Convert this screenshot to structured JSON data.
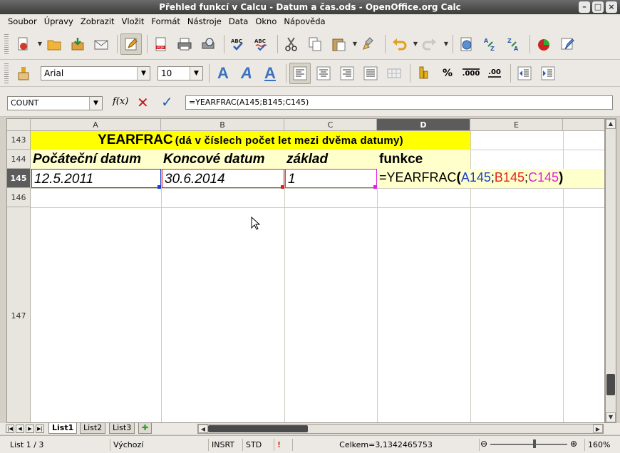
{
  "window": {
    "title": "Přehled funkcí v Calcu - Datum a čas.ods - OpenOffice.org Calc"
  },
  "menu": [
    "Soubor",
    "Úpravy",
    "Zobrazit",
    "Vložit",
    "Formát",
    "Nástroje",
    "Data",
    "Okno",
    "Nápověda"
  ],
  "format_toolbar": {
    "font_name": "Arial",
    "font_size": "10",
    "bold_a": "A",
    "italic_a": "A",
    "under_a": "A",
    "percent": "%",
    "decimal": ".000",
    "decimal2": ".00"
  },
  "formula_bar": {
    "name_box": "COUNT",
    "fx_label": "f(x)",
    "formula": "=YEARFRAC(A145;B145;C145)"
  },
  "columns": [
    "A",
    "B",
    "C",
    "D",
    "E"
  ],
  "selected_column": "D",
  "rows": [
    "143",
    "144",
    "145",
    "146",
    "147"
  ],
  "selected_row": "145",
  "cells": {
    "title_main": "YEARFRAC",
    "title_sub": "(dá v číslech počet let mezi dvěma datumy)",
    "A144": "Počáteční datum",
    "B144": "Koncové datum",
    "C144": "základ",
    "D144": "funkce",
    "A145": "12.5.2011",
    "B145": "30.6.2014",
    "C145": "1",
    "D145_prefix": "=YEARFRAC",
    "D145_open": "(",
    "D145_ref_a": "A145",
    "D145_sep1": ";",
    "D145_ref_b": "B145",
    "D145_sep2": ";",
    "D145_ref_c": "C145",
    "D145_close": ")"
  },
  "sheet_tabs": [
    "List1",
    "List2",
    "List3"
  ],
  "active_sheet": "List1",
  "status": {
    "sheet": "List 1 / 3",
    "style": "Výchozí",
    "insert_mode": "INSRT",
    "selection_mode": "STD",
    "sum": "Celkem=3,1342465753",
    "zoom": "160%"
  },
  "colors": {
    "title_bg": "#ffff00",
    "header_bg": "#ffffcc",
    "ref_a": "#1a3fd0",
    "ref_b": "#e02020",
    "ref_c": "#e020e0"
  }
}
